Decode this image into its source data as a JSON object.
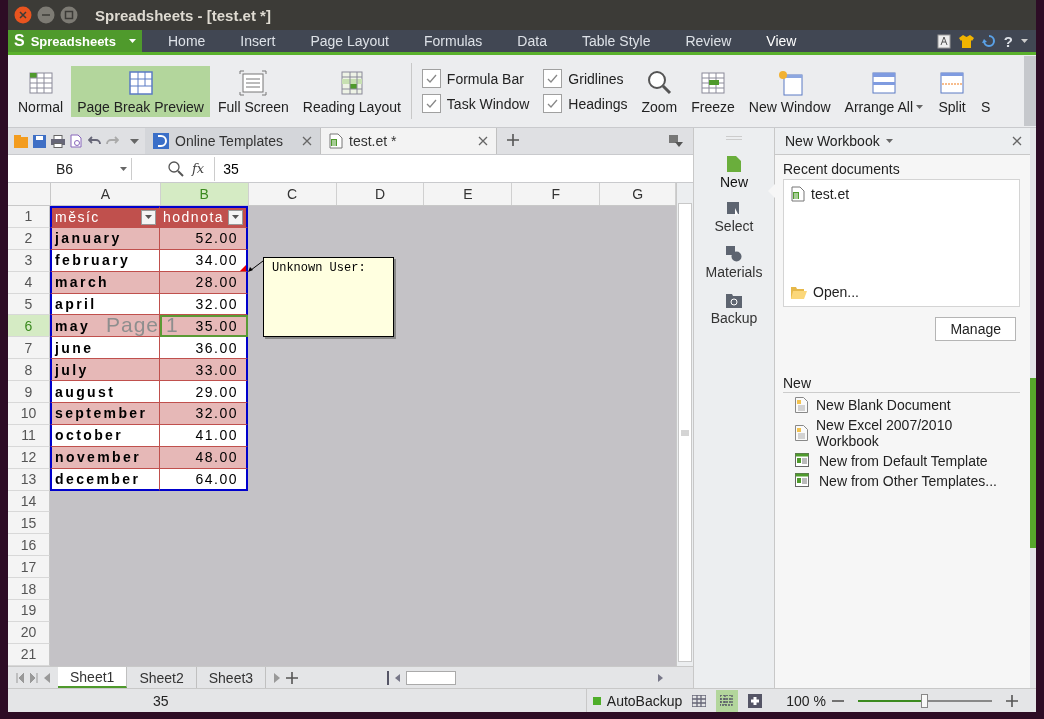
{
  "window": {
    "title": "Spreadsheets - [test.et *]"
  },
  "app_button": {
    "logo": "S",
    "label": "Spreadsheets"
  },
  "menu_tabs": [
    {
      "label": "Home",
      "selected": false
    },
    {
      "label": "Insert",
      "selected": false
    },
    {
      "label": "Page Layout",
      "selected": false
    },
    {
      "label": "Formulas",
      "selected": false
    },
    {
      "label": "Data",
      "selected": false
    },
    {
      "label": "Table Style",
      "selected": false
    },
    {
      "label": "Review",
      "selected": false
    },
    {
      "label": "View",
      "selected": true
    }
  ],
  "help": "?",
  "ribbon": [
    {
      "kind": "button",
      "label": "Normal",
      "selected": false
    },
    {
      "kind": "button",
      "label": "Page Break Preview",
      "selected": true
    },
    {
      "kind": "button",
      "label": "Full Screen",
      "selected": false
    },
    {
      "kind": "button",
      "label": "Reading Layout",
      "selected": false
    },
    {
      "kind": "checks",
      "items": [
        {
          "label": "Formula Bar",
          "checked": true
        },
        {
          "label": "Task Window",
          "checked": true
        }
      ]
    },
    {
      "kind": "checks",
      "items": [
        {
          "label": "Gridlines",
          "checked": true
        },
        {
          "label": "Headings",
          "checked": true
        }
      ]
    },
    {
      "kind": "button",
      "label": "Zoom",
      "selected": false
    },
    {
      "kind": "button",
      "label": "Freeze",
      "selected": false
    },
    {
      "kind": "button",
      "label": "New Window",
      "selected": false
    },
    {
      "kind": "button",
      "label": "Arrange All",
      "selected": false,
      "dropdown": true
    },
    {
      "kind": "button",
      "label": "Split",
      "selected": false
    },
    {
      "kind": "button",
      "label": "S",
      "selected": false
    }
  ],
  "doc_tabs": [
    {
      "label": "Online Templates",
      "selected": false
    },
    {
      "label": "test.et *",
      "selected": true
    }
  ],
  "formula_bar": {
    "name_box": "B6",
    "fx": "fx",
    "value": "35"
  },
  "columns": [
    {
      "label": "A",
      "selected": false
    },
    {
      "label": "B",
      "selected": true
    },
    {
      "label": "C",
      "selected": false
    },
    {
      "label": "D",
      "selected": false
    },
    {
      "label": "E",
      "selected": false
    },
    {
      "label": "F",
      "selected": false
    },
    {
      "label": "G",
      "selected": false
    }
  ],
  "rows": [
    {
      "label": "1",
      "selected": false,
      "kind": "header",
      "cells": [
        "měsíc",
        "hodnota"
      ]
    },
    {
      "label": "2",
      "selected": false,
      "kind": "data",
      "banded": true,
      "cells": [
        "january",
        "52.00"
      ]
    },
    {
      "label": "3",
      "selected": false,
      "kind": "data",
      "banded": false,
      "cells": [
        "february",
        "34.00"
      ]
    },
    {
      "label": "4",
      "selected": false,
      "kind": "data",
      "banded": true,
      "cells": [
        "march",
        "28.00"
      ]
    },
    {
      "label": "5",
      "selected": false,
      "kind": "data",
      "banded": false,
      "cells": [
        "april",
        "32.00"
      ]
    },
    {
      "label": "6",
      "selected": true,
      "kind": "data",
      "banded": true,
      "cells": [
        "may",
        "35.00"
      ]
    },
    {
      "label": "7",
      "selected": false,
      "kind": "data",
      "banded": false,
      "cells": [
        "june",
        "36.00"
      ]
    },
    {
      "label": "8",
      "selected": false,
      "kind": "data",
      "banded": true,
      "cells": [
        "july",
        "33.00"
      ]
    },
    {
      "label": "9",
      "selected": false,
      "kind": "data",
      "banded": false,
      "cells": [
        "august",
        "29.00"
      ]
    },
    {
      "label": "10",
      "selected": false,
      "kind": "data",
      "banded": true,
      "cells": [
        "september",
        "32.00"
      ]
    },
    {
      "label": "11",
      "selected": false,
      "kind": "data",
      "banded": false,
      "cells": [
        "october",
        "41.00"
      ]
    },
    {
      "label": "12",
      "selected": false,
      "kind": "data",
      "banded": true,
      "cells": [
        "november",
        "48.00"
      ]
    },
    {
      "label": "13",
      "selected": false,
      "kind": "data",
      "banded": false,
      "cells": [
        "december",
        "64.00"
      ]
    },
    {
      "label": "14",
      "selected": false,
      "kind": "empty"
    },
    {
      "label": "15",
      "selected": false,
      "kind": "empty"
    },
    {
      "label": "16",
      "selected": false,
      "kind": "empty"
    },
    {
      "label": "17",
      "selected": false,
      "kind": "empty"
    },
    {
      "label": "18",
      "selected": false,
      "kind": "empty"
    },
    {
      "label": "19",
      "selected": false,
      "kind": "empty"
    },
    {
      "label": "20",
      "selected": false,
      "kind": "empty"
    },
    {
      "label": "21",
      "selected": false,
      "kind": "empty"
    }
  ],
  "comment": {
    "author": "Unknown User:"
  },
  "watermark": "Page 1",
  "sheet_tabs": [
    {
      "label": "Sheet1",
      "selected": true
    },
    {
      "label": "Sheet2",
      "selected": false
    },
    {
      "label": "Sheet3",
      "selected": false
    }
  ],
  "status_bar": {
    "value": "35",
    "autobackup": "AutoBackup",
    "view_modes": [
      {
        "selected": false
      },
      {
        "selected": true
      },
      {
        "selected": false
      }
    ],
    "zoom": "100 %",
    "zoom_slider": {
      "level": 0.5
    }
  },
  "task_nav": [
    {
      "label": "New",
      "selected": true
    },
    {
      "label": "Select",
      "selected": false
    },
    {
      "label": "Materials",
      "selected": false
    },
    {
      "label": "Backup",
      "selected": false
    }
  ],
  "task_pane": {
    "title": "New Workbook",
    "recent_heading": "Recent documents",
    "recent": [
      "test.et"
    ],
    "open": "Open...",
    "manage": "Manage",
    "new_heading": "New",
    "new_items": [
      "New Blank Document",
      "New Excel 2007/2010 Workbook",
      "New from Default Template",
      "New from Other Templates..."
    ]
  }
}
